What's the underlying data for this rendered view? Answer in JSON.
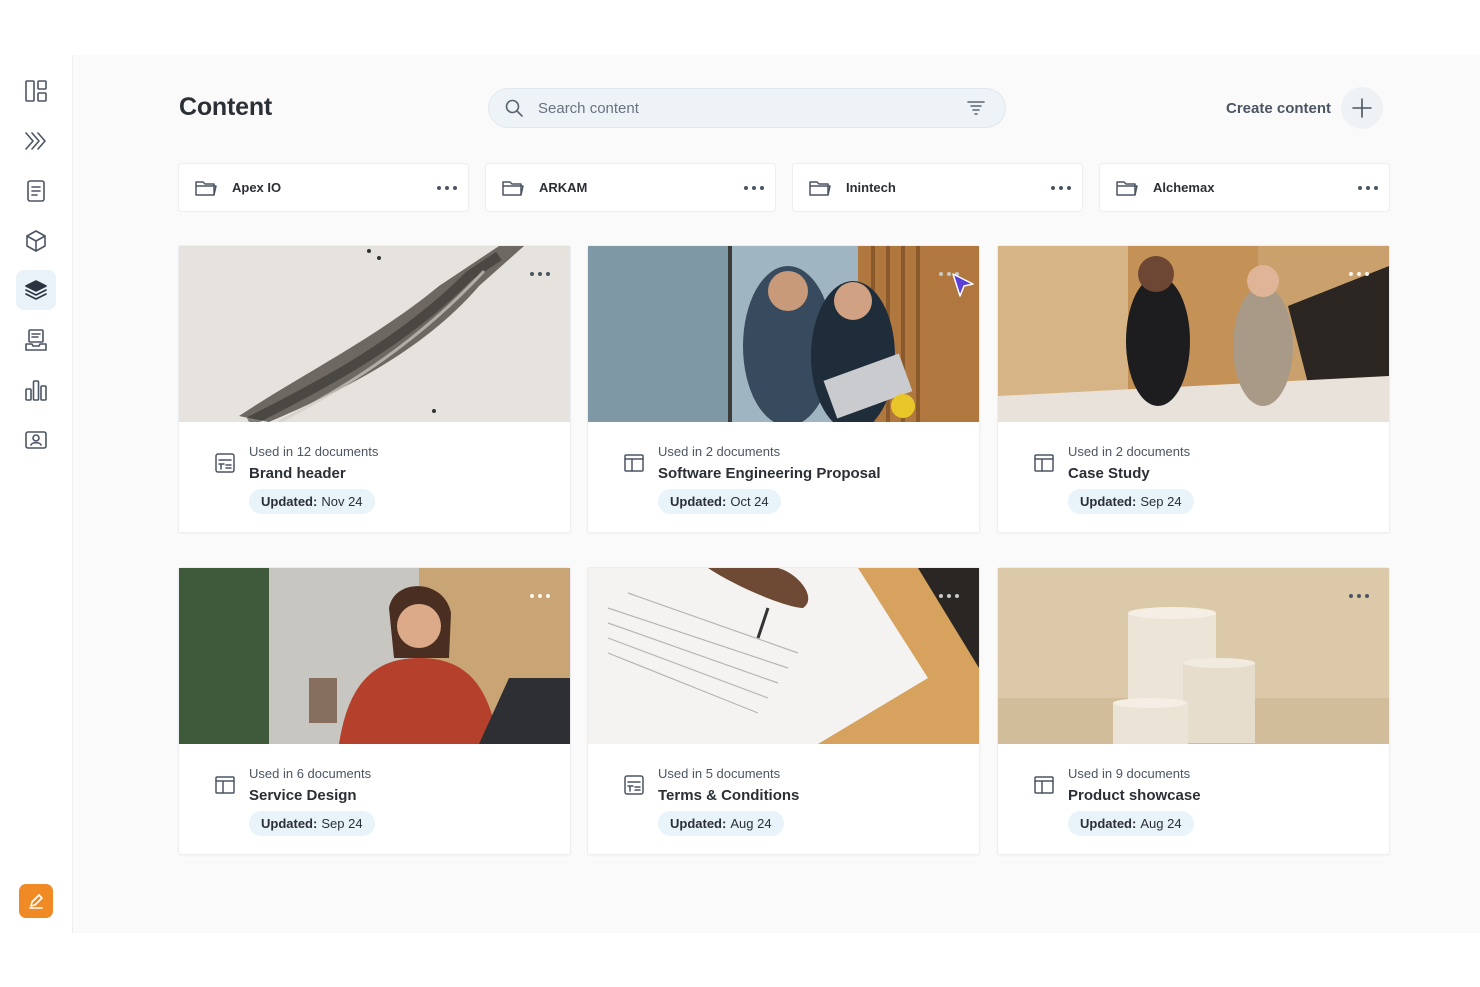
{
  "page": {
    "title": "Content"
  },
  "search": {
    "placeholder": "Search content"
  },
  "header": {
    "create_label": "Create content"
  },
  "sidebar": {
    "items": [
      {
        "name": "dashboard-icon",
        "active": false
      },
      {
        "name": "chevrons-right-icon",
        "active": false
      },
      {
        "name": "document-icon",
        "active": false
      },
      {
        "name": "box-icon",
        "active": false
      },
      {
        "name": "layers-icon",
        "active": true
      },
      {
        "name": "inbox-stack-icon",
        "active": false
      },
      {
        "name": "bar-chart-icon",
        "active": false
      },
      {
        "name": "contact-card-icon",
        "active": false
      }
    ],
    "compose_icon": "pencil-icon",
    "compose_color": "#f08a24"
  },
  "folders": [
    {
      "name": "Apex IO"
    },
    {
      "name": "ARKAM"
    },
    {
      "name": "Inintech"
    },
    {
      "name": "Alchemax"
    }
  ],
  "cards": [
    {
      "usage": "Used in 12 documents",
      "title": "Brand header",
      "updated_label": "Updated:",
      "updated_value": "Nov 24",
      "type_icon": "text-block-icon"
    },
    {
      "usage": "Used in 2 documents",
      "title": "Software Engineering Proposal",
      "updated_label": "Updated:",
      "updated_value": "Oct 24",
      "type_icon": "layout-icon"
    },
    {
      "usage": "Used in 2 documents",
      "title": "Case Study",
      "updated_label": "Updated:",
      "updated_value": "Sep 24",
      "type_icon": "layout-icon"
    },
    {
      "usage": "Used in 6 documents",
      "title": "Service Design",
      "updated_label": "Updated:",
      "updated_value": "Sep 24",
      "type_icon": "layout-icon"
    },
    {
      "usage": "Used in 5 documents",
      "title": "Terms & Conditions",
      "updated_label": "Updated:",
      "updated_value": "Aug 24",
      "type_icon": "text-block-icon"
    },
    {
      "usage": "Used in 9 documents",
      "title": "Product showcase",
      "updated_label": "Updated:",
      "updated_value": "Aug 24",
      "type_icon": "layout-icon"
    }
  ],
  "colors": {
    "accent": "#f08a24",
    "badge_bg": "#e8f3fa",
    "active_nav": "#e9f2f8",
    "cursor": "#5b3fd6"
  }
}
